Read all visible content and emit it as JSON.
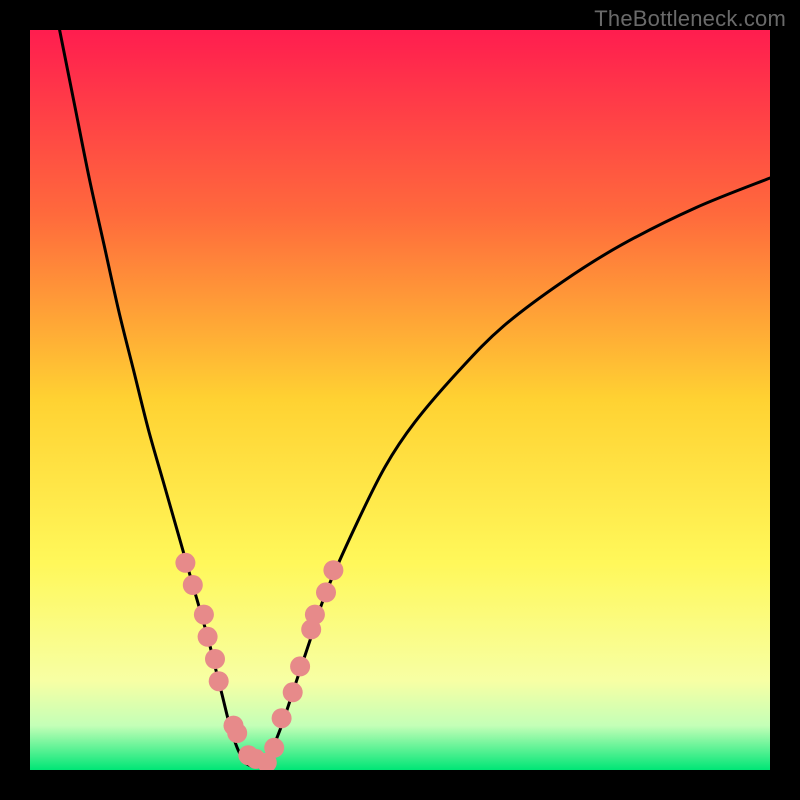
{
  "watermark": "TheBottleneck.com",
  "chart_data": {
    "type": "line",
    "title": "",
    "xlabel": "",
    "ylabel": "",
    "x_range": [
      0,
      100
    ],
    "y_range": [
      0,
      100
    ],
    "background": {
      "orientation": "vertical",
      "stops": [
        {
          "pct": 0,
          "color": "#ff1d4f"
        },
        {
          "pct": 25,
          "color": "#ff6a3c"
        },
        {
          "pct": 50,
          "color": "#ffd232"
        },
        {
          "pct": 72,
          "color": "#fff85a"
        },
        {
          "pct": 88,
          "color": "#f7ffa4"
        },
        {
          "pct": 94,
          "color": "#c4ffb7"
        },
        {
          "pct": 100,
          "color": "#00e676"
        }
      ]
    },
    "series": [
      {
        "name": "left-curve",
        "color": "#000000",
        "x": [
          4,
          6,
          8,
          10,
          12,
          14,
          16,
          18,
          20,
          22,
          24,
          25,
          26,
          27,
          28,
          29
        ],
        "y": [
          100,
          90,
          80,
          71,
          62,
          54,
          46,
          39,
          32,
          25,
          18,
          14,
          10,
          6,
          3,
          1
        ]
      },
      {
        "name": "right-curve",
        "color": "#000000",
        "x": [
          32,
          34,
          36,
          38,
          40,
          44,
          48,
          52,
          58,
          64,
          72,
          80,
          90,
          100
        ],
        "y": [
          1,
          6,
          12,
          18,
          24,
          33,
          41,
          47,
          54,
          60,
          66,
          71,
          76,
          80
        ]
      },
      {
        "name": "valley-floor",
        "color": "#000000",
        "x": [
          29,
          30,
          31,
          32
        ],
        "y": [
          1,
          0.5,
          0.5,
          1
        ]
      }
    ],
    "markers": [
      {
        "name": "left-markers",
        "color": "#e78a8a",
        "radius": 10,
        "x": [
          21,
          22,
          23.5,
          24,
          25,
          25.5,
          27.5,
          28,
          29.5,
          30.5,
          32
        ],
        "y": [
          28,
          25,
          21,
          18,
          15,
          12,
          6,
          5,
          2,
          1.5,
          1
        ]
      },
      {
        "name": "right-markers",
        "color": "#e78a8a",
        "radius": 10,
        "x": [
          33,
          34,
          35.5,
          36.5,
          38,
          38.5,
          40,
          41
        ],
        "y": [
          3,
          7,
          10.5,
          14,
          19,
          21,
          24,
          27
        ]
      }
    ]
  }
}
